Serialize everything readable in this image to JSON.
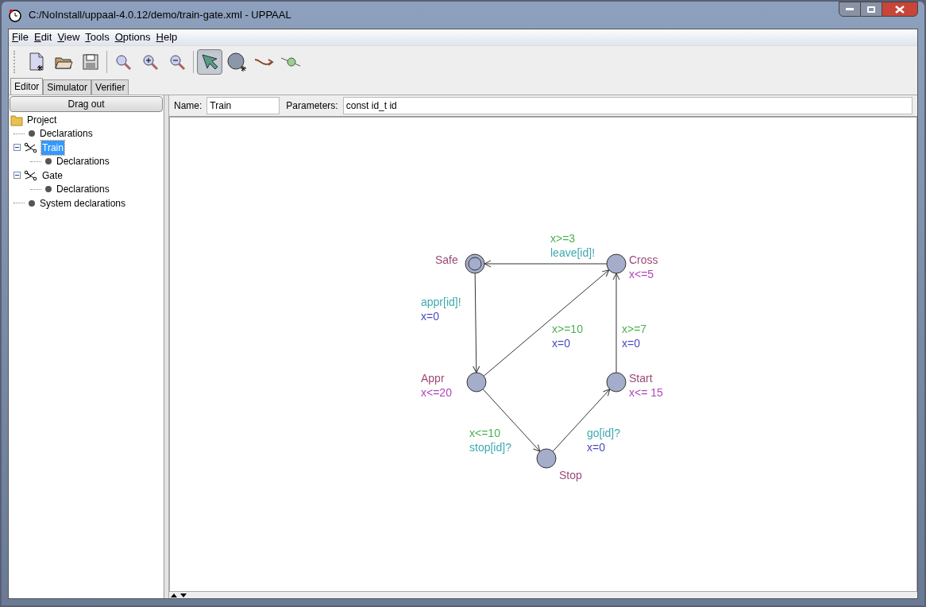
{
  "window": {
    "title": "C:/NoInstall/uppaal-4.0.12/demo/train-gate.xml - UPPAAL"
  },
  "menu": [
    "File",
    "Edit",
    "View",
    "Tools",
    "Options",
    "Help"
  ],
  "toolbar": {
    "file_tools": [
      {
        "kind": "new"
      },
      {
        "kind": "open"
      },
      {
        "kind": "save"
      }
    ],
    "zoom_tools": [
      {
        "kind": "zoom"
      },
      {
        "kind": "zoom-in"
      },
      {
        "kind": "zoom-out"
      }
    ],
    "edit_tools": [
      {
        "kind": "select",
        "selected": true
      },
      {
        "kind": "location",
        "selected": false
      },
      {
        "kind": "edge",
        "selected": false
      },
      {
        "kind": "nail",
        "selected": false
      }
    ]
  },
  "tabs": [
    {
      "label": "Editor",
      "selected": true
    },
    {
      "label": "Simulator",
      "selected": false
    },
    {
      "label": "Verifier",
      "selected": false
    }
  ],
  "drag_out_button": "Drag out",
  "tree": [
    {
      "label": "Project",
      "kind": "folder",
      "selected": false,
      "children": [
        {
          "label": "Declarations",
          "kind": "declarations",
          "selected": false
        },
        {
          "label": "Train",
          "kind": "template",
          "selected": true,
          "expanded": true,
          "children": [
            {
              "label": "Declarations",
              "kind": "declarations",
              "selected": false
            }
          ]
        },
        {
          "label": "Gate",
          "kind": "template",
          "selected": false,
          "expanded": true,
          "children": [
            {
              "label": "Declarations",
              "kind": "declarations",
              "selected": false
            }
          ]
        },
        {
          "label": "System declarations",
          "kind": "declarations",
          "selected": false
        }
      ]
    }
  ],
  "template": {
    "name_label": "Name:",
    "name": "Train",
    "parameters_label": "Parameters:",
    "parameters": "const id_t id"
  },
  "locations": [
    {
      "name": "Safe",
      "initial": true
    },
    {
      "name": "Cross",
      "invariant": "x<=5",
      "initial": false
    },
    {
      "name": "Appr",
      "invariant": "x<=20",
      "initial": false
    },
    {
      "name": "Start",
      "invariant": "x<= 15",
      "initial": false
    },
    {
      "name": "Stop",
      "initial": false
    }
  ],
  "edges": [
    {
      "labels": [
        {
          "kind": "guard",
          "text": "x>=3"
        },
        {
          "kind": "sync",
          "text": "leave[id]!"
        }
      ]
    },
    {
      "labels": [
        {
          "kind": "sync",
          "text": "appr[id]!"
        },
        {
          "kind": "update",
          "text": "x=0"
        }
      ]
    },
    {
      "labels": [
        {
          "kind": "guard",
          "text": "x>=10"
        },
        {
          "kind": "update",
          "text": "x=0"
        }
      ]
    },
    {
      "labels": [
        {
          "kind": "guard",
          "text": "x>=7"
        },
        {
          "kind": "update",
          "text": "x=0"
        }
      ]
    },
    {
      "labels": [
        {
          "kind": "guard",
          "text": "x<=10"
        },
        {
          "kind": "sync",
          "text": "stop[id]?"
        }
      ]
    },
    {
      "labels": [
        {
          "kind": "sync",
          "text": "go[id]?"
        },
        {
          "kind": "update",
          "text": "x=0"
        }
      ]
    }
  ]
}
